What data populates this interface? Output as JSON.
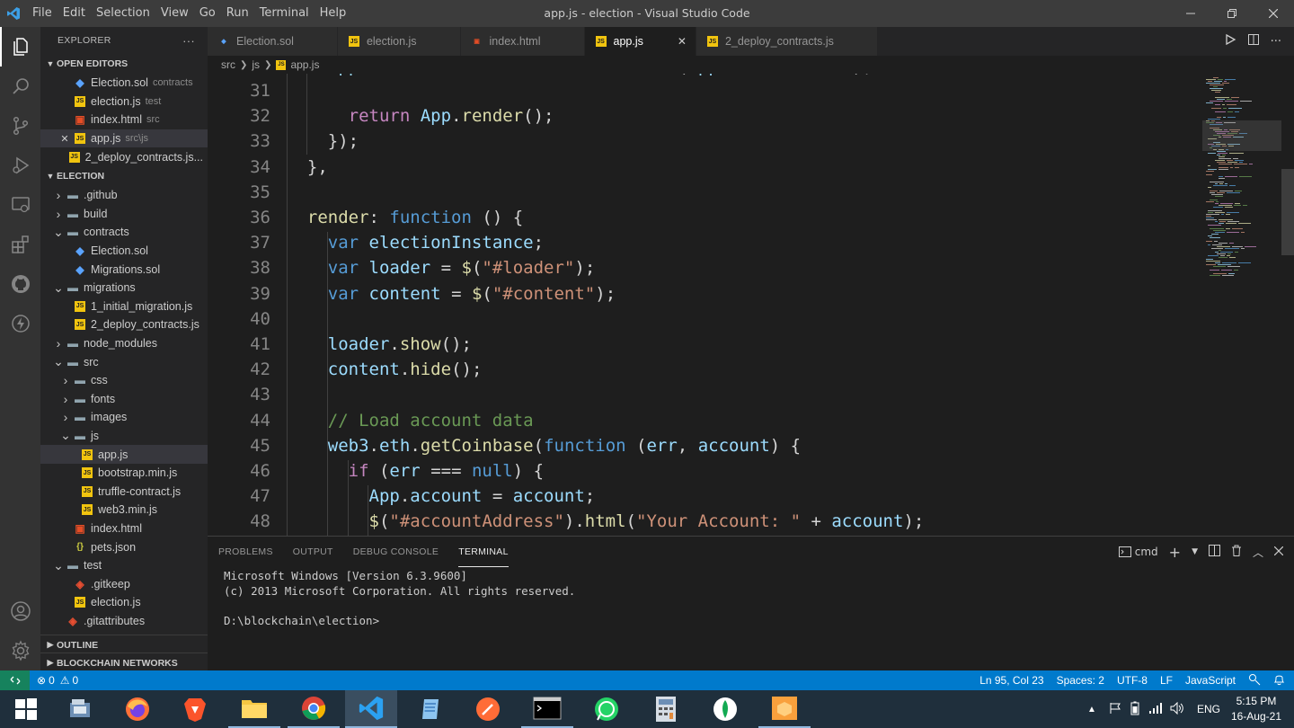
{
  "window": {
    "title": "app.js - election - Visual Studio Code",
    "menu": [
      "File",
      "Edit",
      "Selection",
      "View",
      "Go",
      "Run",
      "Terminal",
      "Help"
    ]
  },
  "sidebar": {
    "title": "EXPLORER",
    "more": "···",
    "open_editors": {
      "label": "OPEN EDITORS",
      "items": [
        {
          "name": "Election.sol",
          "desc": "contracts",
          "type": "sol"
        },
        {
          "name": "election.js",
          "desc": "test",
          "type": "js"
        },
        {
          "name": "index.html",
          "desc": "src",
          "type": "html"
        },
        {
          "name": "app.js",
          "desc": "src\\js",
          "type": "js",
          "active": true
        },
        {
          "name": "2_deploy_contracts.js...",
          "desc": "",
          "type": "js"
        }
      ]
    },
    "project": {
      "label": "ELECTION",
      "items": [
        {
          "name": ".github",
          "kind": "folder",
          "expanded": false,
          "depth": 0
        },
        {
          "name": "build",
          "kind": "folder",
          "expanded": false,
          "depth": 0
        },
        {
          "name": "contracts",
          "kind": "folder",
          "expanded": true,
          "depth": 0
        },
        {
          "name": "Election.sol",
          "kind": "sol",
          "depth": 1
        },
        {
          "name": "Migrations.sol",
          "kind": "sol",
          "depth": 1
        },
        {
          "name": "migrations",
          "kind": "folder",
          "expanded": true,
          "depth": 0
        },
        {
          "name": "1_initial_migration.js",
          "kind": "js",
          "depth": 1
        },
        {
          "name": "2_deploy_contracts.js",
          "kind": "js",
          "depth": 1
        },
        {
          "name": "node_modules",
          "kind": "folder",
          "expanded": false,
          "depth": 0
        },
        {
          "name": "src",
          "kind": "folder",
          "expanded": true,
          "depth": 0
        },
        {
          "name": "css",
          "kind": "folder",
          "expanded": false,
          "depth": 1
        },
        {
          "name": "fonts",
          "kind": "folder",
          "expanded": false,
          "depth": 1
        },
        {
          "name": "images",
          "kind": "folder",
          "expanded": false,
          "depth": 1
        },
        {
          "name": "js",
          "kind": "folder",
          "expanded": true,
          "depth": 1
        },
        {
          "name": "app.js",
          "kind": "js",
          "depth": 2,
          "selected": true
        },
        {
          "name": "bootstrap.min.js",
          "kind": "js",
          "depth": 2
        },
        {
          "name": "truffle-contract.js",
          "kind": "js",
          "depth": 2
        },
        {
          "name": "web3.min.js",
          "kind": "js",
          "depth": 2
        },
        {
          "name": "index.html",
          "kind": "html",
          "depth": 1
        },
        {
          "name": "pets.json",
          "kind": "json",
          "depth": 1
        },
        {
          "name": "test",
          "kind": "folder",
          "expanded": true,
          "depth": 0
        },
        {
          "name": ".gitkeep",
          "kind": "git",
          "depth": 1
        },
        {
          "name": "election.js",
          "kind": "js",
          "depth": 1
        },
        {
          "name": ".gitattributes",
          "kind": "git",
          "depth": 0
        }
      ]
    },
    "outline_label": "OUTLINE",
    "networks_label": "BLOCKCHAIN NETWORKS"
  },
  "tabs": [
    {
      "name": "Election.sol",
      "type": "sol"
    },
    {
      "name": "election.js",
      "type": "js"
    },
    {
      "name": "index.html",
      "type": "html"
    },
    {
      "name": "app.js",
      "type": "js",
      "active": true
    },
    {
      "name": "2_deploy_contracts.js",
      "type": "js"
    }
  ],
  "breadcrumb": [
    "src",
    "js",
    "app.js"
  ],
  "editor": {
    "lines": [
      {
        "n": "31",
        "html": ""
      },
      {
        "n": "32",
        "html": "      <span class='ctl'>return</span> <span class='var'>App</span>.<span class='fn'>render</span>();"
      },
      {
        "n": "33",
        "html": "    });"
      },
      {
        "n": "34",
        "html": "  },"
      },
      {
        "n": "35",
        "html": ""
      },
      {
        "n": "36",
        "html": "  <span class='fn'>render</span>: <span class='kw'>function</span> () {"
      },
      {
        "n": "37",
        "html": "    <span class='kw'>var</span> <span class='var'>electionInstance</span>;"
      },
      {
        "n": "38",
        "html": "    <span class='kw'>var</span> <span class='var'>loader</span> = <span class='fn'>$</span>(<span class='str'>\"#loader\"</span>);"
      },
      {
        "n": "39",
        "html": "    <span class='kw'>var</span> <span class='var'>content</span> = <span class='fn'>$</span>(<span class='str'>\"#content\"</span>);"
      },
      {
        "n": "40",
        "html": ""
      },
      {
        "n": "41",
        "html": "    <span class='var'>loader</span>.<span class='fn'>show</span>();"
      },
      {
        "n": "42",
        "html": "    <span class='var'>content</span>.<span class='fn'>hide</span>();"
      },
      {
        "n": "43",
        "html": ""
      },
      {
        "n": "44",
        "html": "    <span class='cm'>// Load account data</span>"
      },
      {
        "n": "45",
        "html": "    <span class='var'>web3</span>.<span class='var'>eth</span>.<span class='fn'>getCoinbase</span>(<span class='kw'>function</span> (<span class='var'>err</span>, <span class='var'>account</span>) {"
      },
      {
        "n": "46",
        "html": "      <span class='ctl'>if</span> (<span class='var'>err</span> === <span class='kw'>null</span>) {"
      },
      {
        "n": "47",
        "html": "        <span class='var'>App</span>.<span class='var'>account</span> = <span class='var'>account</span>;"
      },
      {
        "n": "48",
        "html": "        <span class='fn'>$</span>(<span class='str'>\"#accountAddress\"</span>).<span class='fn'>html</span>(<span class='str'>\"Your Account: \"</span> + <span class='var'>account</span>);"
      }
    ]
  },
  "panel": {
    "tabs": [
      "PROBLEMS",
      "OUTPUT",
      "DEBUG CONSOLE",
      "TERMINAL"
    ],
    "active_tab": "TERMINAL",
    "shell": "cmd",
    "terminal_lines": [
      "Microsoft Windows [Version 6.3.9600]",
      "(c) 2013 Microsoft Corporation. All rights reserved.",
      "",
      "D:\\blockchain\\election>"
    ]
  },
  "status": {
    "errors": "0",
    "warnings": "0",
    "position": "Ln 95, Col 23",
    "spaces": "Spaces: 2",
    "encoding": "UTF-8",
    "eol": "LF",
    "language": "JavaScript"
  },
  "taskbar": {
    "apps": [
      "windows-start",
      "control-panel",
      "firefox",
      "brave",
      "file-explorer",
      "chrome",
      "vscode",
      "notepad",
      "postman",
      "cmd",
      "whatsapp",
      "calculator",
      "mongodb",
      "sublime"
    ],
    "language": "ENG",
    "time": "5:15 PM",
    "date": "16-Aug-21"
  },
  "colors": {
    "accent": "#007acc",
    "js_icon": "#f1c40f",
    "html_icon": "#e44d26"
  }
}
